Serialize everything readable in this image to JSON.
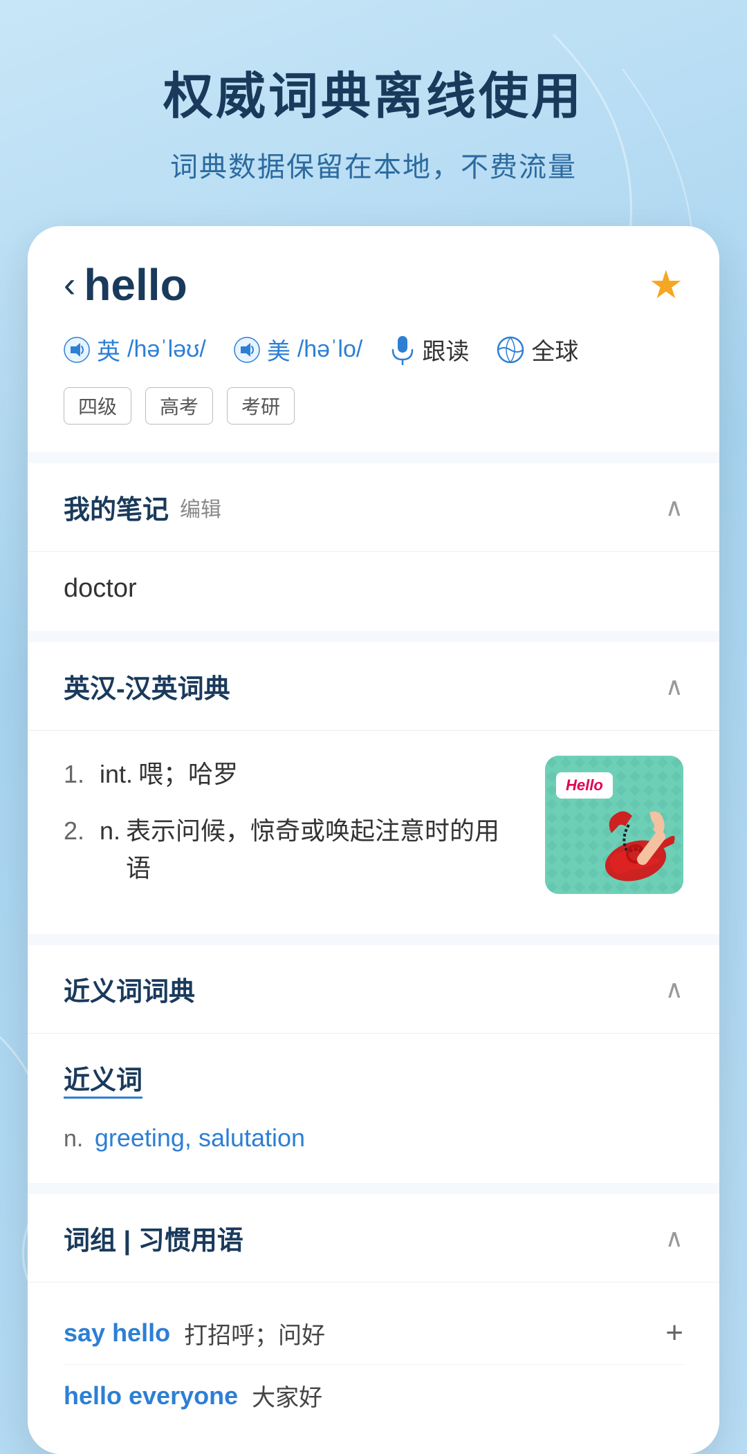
{
  "background": {
    "gradient_start": "#c8e6f7",
    "gradient_end": "#a8d4f0"
  },
  "top_section": {
    "main_title": "权威词典离线使用",
    "sub_title": "词典数据保留在本地，不费流量"
  },
  "card": {
    "word": "hello",
    "back_icon": "‹",
    "star_label": "★",
    "pronunciation": {
      "uk_label": "英",
      "uk_ipa": "/həˈləʊ/",
      "us_label": "美",
      "us_ipa": "/həˈlo/",
      "follow_read": "跟读",
      "global": "全球"
    },
    "tags": [
      "四级",
      "高考",
      "考研"
    ],
    "sections": {
      "notes": {
        "title": "我的笔记",
        "edit_label": "编辑",
        "content": "doctor"
      },
      "dictionary": {
        "title": "英汉-汉英词典",
        "definitions": [
          {
            "num": "1.",
            "pos": "int.",
            "text": "喂；哈罗"
          },
          {
            "num": "2.",
            "pos": "n.",
            "text": "表示问候，惊奇或唤起注意时的用语"
          }
        ],
        "image_alt": "hello telephone illustration",
        "image_label": "Hello"
      },
      "synonyms": {
        "title": "近义词词典",
        "synonym_label": "近义词",
        "pos": "n.",
        "words": "greeting, salutation"
      },
      "phrases": {
        "title": "词组 | 习惯用语",
        "items": [
          {
            "phrase": "say hello",
            "meaning": "打招呼；问好"
          },
          {
            "phrase": "hello everyone",
            "meaning": "大家好"
          }
        ]
      }
    }
  }
}
